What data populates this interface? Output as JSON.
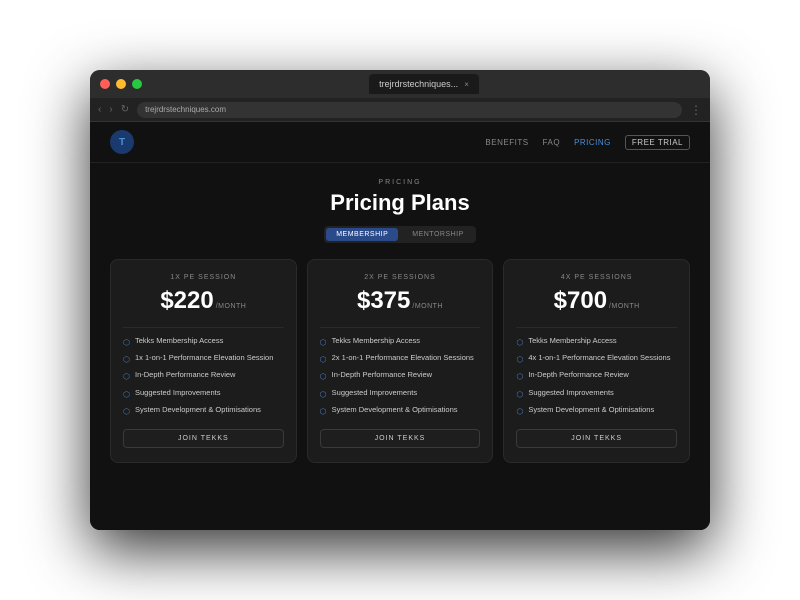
{
  "browser": {
    "tab_title": "trejrdrstechniques...",
    "url": "trejrdrstechniques.com",
    "tab_close": "×"
  },
  "nav": {
    "logo_text": "T",
    "items": [
      {
        "label": "BENEFITS",
        "active": false
      },
      {
        "label": "FAQ",
        "active": false
      },
      {
        "label": "PRICING",
        "active": true
      },
      {
        "label": "FREE TRIAL",
        "active": false,
        "cta": true
      }
    ]
  },
  "pricing": {
    "label": "PRICING",
    "title": "Pricing Plans",
    "toggle": {
      "options": [
        {
          "label": "MEMBERSHIP",
          "active": true
        },
        {
          "label": "MENTORSHIP",
          "active": false
        }
      ]
    },
    "plans": [
      {
        "sessions": "1X PE SESSION",
        "price": "$220",
        "period": "/MONTH",
        "features": [
          "Tekks Membership Access",
          "1x 1-on-1 Performance Elevation Session",
          "In-Depth Performance Review",
          "Suggested Improvements",
          "System Development & Optimisations"
        ],
        "cta": "JOIN TEKKS"
      },
      {
        "sessions": "2X PE SESSIONS",
        "price": "$375",
        "period": "/MONTH",
        "features": [
          "Tekks Membership Access",
          "2x 1-on-1 Performance Elevation Sessions",
          "In-Depth Performance Review",
          "Suggested Improvements",
          "System Development & Optimisations"
        ],
        "cta": "JOIN TEKKS"
      },
      {
        "sessions": "4X PE SESSIONS",
        "price": "$700",
        "period": "/MONTH",
        "features": [
          "Tekks Membership Access",
          "4x 1-on-1 Performance Elevation Sessions",
          "In-Depth Performance Review",
          "Suggested Improvements",
          "System Development & Optimisations"
        ],
        "cta": "JOIN TEKKS"
      }
    ]
  }
}
